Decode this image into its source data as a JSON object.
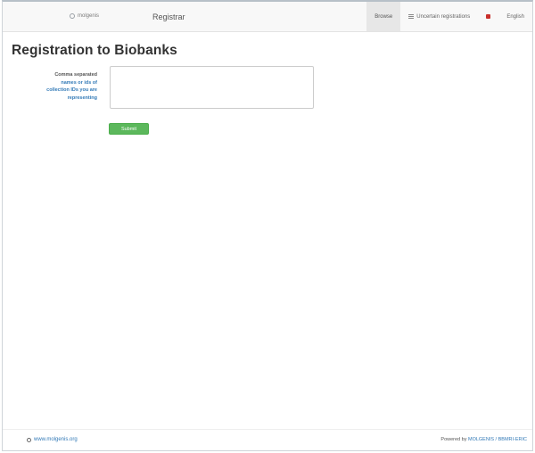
{
  "navbar": {
    "logo_text": "molgenis",
    "title": "Registrar",
    "items": [
      {
        "label": "Browse"
      },
      {
        "label": "Uncertain registrations"
      },
      {
        "label": "English"
      }
    ]
  },
  "page": {
    "title": "Registration to Biobanks"
  },
  "form": {
    "label_line1": "Comma separated",
    "label_line2": "names or ids of",
    "label_line3": "collection IDs you are",
    "label_line4": "representing",
    "textarea_value": "",
    "submit_label": "Submit"
  },
  "footer": {
    "left_text": "www.molgenis.org",
    "right_prefix": "Powered by ",
    "right_link": "MOLGENIS / BBMRI-ERIC"
  },
  "colors": {
    "primary": "#337ab7",
    "success": "#5cb85c",
    "flag": "#c9302c"
  }
}
